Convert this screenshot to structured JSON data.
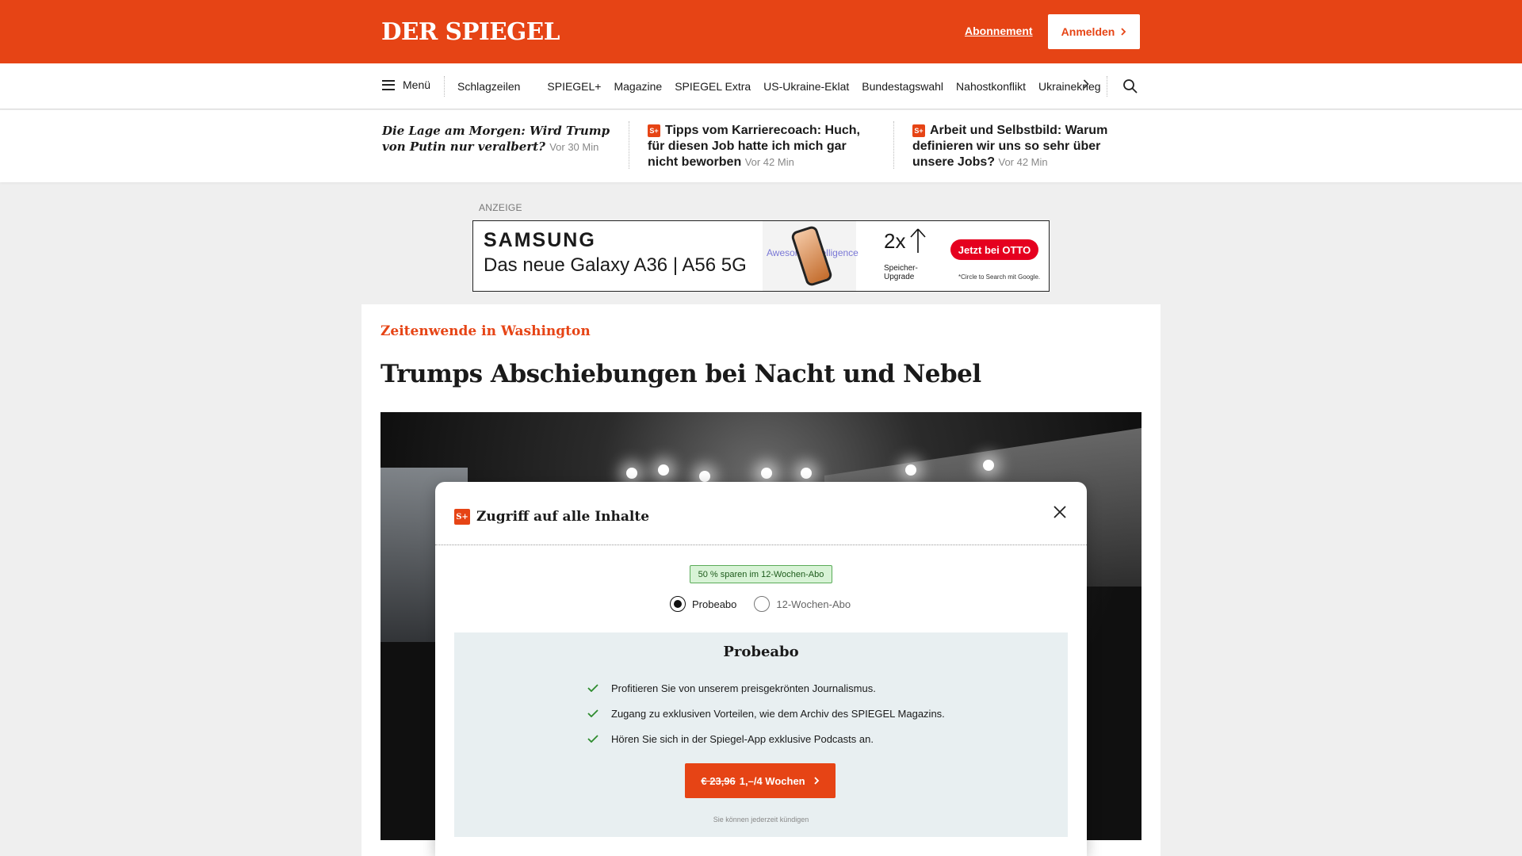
{
  "header": {
    "logo": "DER SPIEGEL",
    "abo_link": "Abonnement",
    "login_label": "Anmelden",
    "accent_color": "#e64415"
  },
  "nav": {
    "menu_label": "Menü",
    "items": [
      "Schlagzeilen",
      "SPIEGEL+",
      "Magazine",
      "SPIEGEL Extra",
      "US-Ukraine-Eklat",
      "Bundestagswahl",
      "Nahostkonflikt",
      "Ukrainekrieg"
    ],
    "next_icon": "chevron-right-icon",
    "search_icon": "search-icon"
  },
  "teasers": [
    {
      "title": "Die Lage am Morgen: Wird Trump von Putin nur veralbert?",
      "time": "Vor 30 Min",
      "plus": false
    },
    {
      "title": "Tipps vom Karrierecoach: Huch, für diesen Job hatte ich mich gar nicht beworben",
      "time": "Vor 42 Min",
      "plus": true,
      "badge": "S+"
    },
    {
      "title": "Arbeit und Selbstbild: Warum definieren wir uns so sehr über unsere Jobs?",
      "time": "Vor 42 Min",
      "plus": true,
      "badge": "S+"
    }
  ],
  "ad": {
    "label": "ANZEIGE",
    "brand": "SAMSUNG",
    "product": "Das neue Galaxy A36 | A56 5G",
    "side_text": "Awesome intelligence",
    "upgrade_big": "2x",
    "upgrade_small": "Speicher-Upgrade",
    "cta": "Jetzt bei OTTO",
    "fineprint": "*Circle to Search mit Google."
  },
  "article": {
    "kicker": "Zeitenwende in Washington",
    "headline": "Trumps Abschiebungen bei Nacht und Nebel"
  },
  "modal": {
    "title": "Zugriff auf alle Inhalte",
    "badge": "S+",
    "save_badge": "50 % sparen im 12-Wochen-Abo",
    "options": [
      {
        "label": "Probeabo",
        "selected": true
      },
      {
        "label": "12-Wochen-Abo",
        "selected": false
      }
    ],
    "plan_title": "Probeabo",
    "benefits": [
      "Profitieren Sie von unserem preisgekrönten Journalismus.",
      "Zugang zu exklusiven Vorteilen, wie dem Archiv des SPIEGEL Magazins.",
      "Hören Sie sich in der Spiegel-App exklusive Podcasts an."
    ],
    "cta_old_price": "€ 23,96",
    "cta_new_price": "1,–/4 Wochen",
    "cancel_note": "Sie können jederzeit kündigen"
  }
}
